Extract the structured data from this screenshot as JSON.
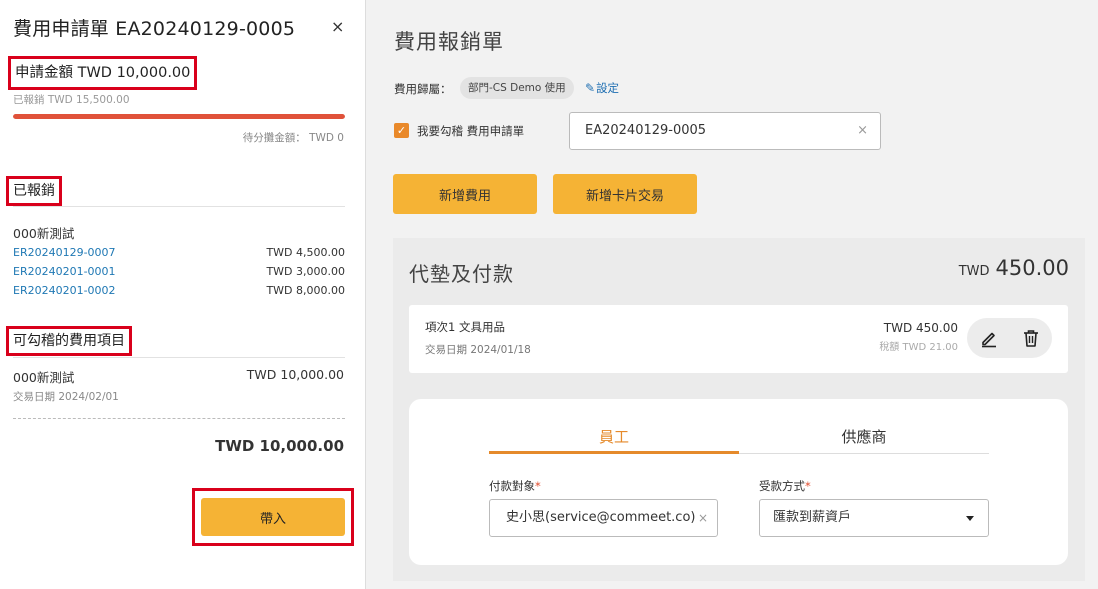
{
  "panel": {
    "title": "費用申請單 EA20240129-0005",
    "close_label": "×",
    "requested_amount": "申請金額 TWD 10,000.00",
    "reimbursed_note": "已報銷 TWD 15,500.00",
    "progress_percent": 100,
    "progress_color": "#e0523a",
    "pending_allocation": "待分攤金額： TWD 0",
    "reimbursed_section": {
      "heading": "已報銷",
      "group_label": "000新測試",
      "rows": [
        {
          "id": "ER20240129-0007",
          "amount": "TWD 4,500.00"
        },
        {
          "id": "ER20240201-0001",
          "amount": "TWD 3,000.00"
        },
        {
          "id": "ER20240201-0002",
          "amount": "TWD 8,000.00"
        }
      ]
    },
    "checkable_section": {
      "heading": "可勾稽的費用項目",
      "item_label": "000新測試",
      "item_amount": "TWD 10,000.00",
      "item_date": "交易日期 2024/02/01",
      "total": "TWD 10,000.00"
    },
    "import_button": "帶入"
  },
  "main": {
    "title": "費用報銷單",
    "belong_label": "費用歸屬：",
    "belong_value": "部門-CS Demo 使用",
    "set_link": "設定",
    "checkbox_label": "我要勾稽 費用申請單",
    "checkbox_checked": true,
    "ref_value": "EA20240129-0005",
    "ref_clear": "×",
    "add_expense_button": "新增費用",
    "add_card_button": "新增卡片交易",
    "advance": {
      "title": "代墊及付款",
      "currency": "TWD",
      "total": "450.00",
      "item": {
        "label": "項次1  文具用品",
        "date": "交易日期 2024/01/18",
        "amount": "TWD 450.00",
        "tax": "稅額 TWD 21.00"
      },
      "tabs": [
        {
          "label": "員工",
          "active": true
        },
        {
          "label": "供應商",
          "active": false
        }
      ],
      "payee_label": "付款對象",
      "payee_value": "史小思(service@commeet.co)",
      "payee_clear": "×",
      "method_label": "受款方式",
      "method_value": "匯款到薪資戶",
      "required_mark": "*"
    }
  },
  "colors": {
    "accent": "#f5b335",
    "highlight_border": "#d9001b",
    "tab_active": "#e58a2b",
    "link": "#1f78b4"
  }
}
